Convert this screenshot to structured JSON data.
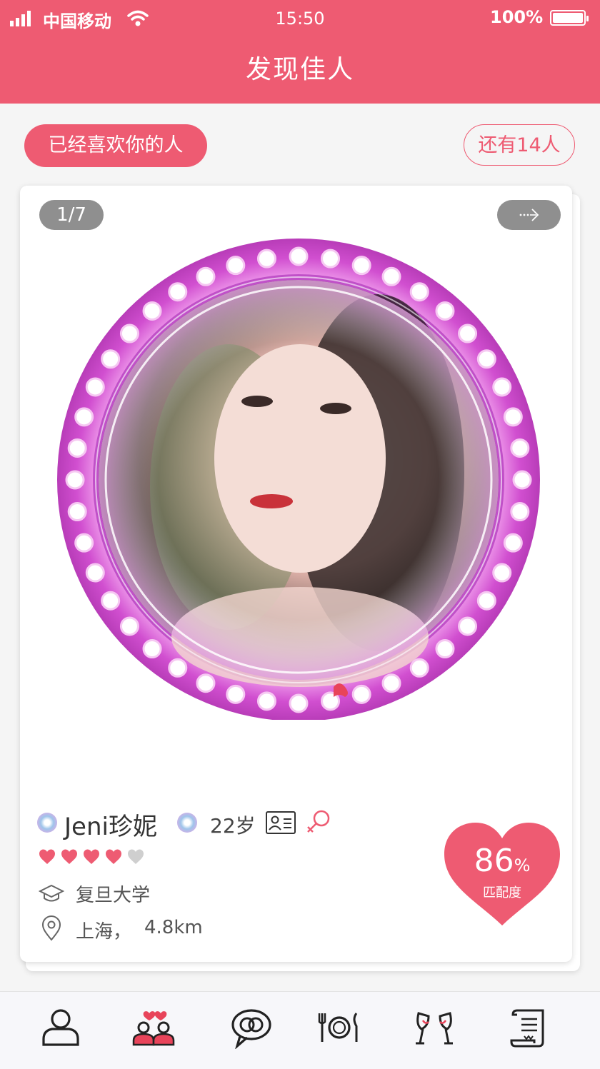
{
  "status": {
    "carrier": "中国移动",
    "time": "15:50",
    "battery": "100%"
  },
  "header": {
    "title": "发现佳人"
  },
  "liked": {
    "label": "已经喜欢你的人",
    "remaining": "还有14人"
  },
  "card": {
    "pager": "1/7",
    "next_label": "···>",
    "profile": {
      "name": "Jeni珍妮",
      "age": "22岁",
      "rating": 4,
      "rating_max": 5,
      "school": "复旦大学",
      "city": "上海，",
      "distance": "4.8km"
    },
    "match": {
      "value": "86",
      "unit": "%",
      "label": "匹配度"
    }
  },
  "tabs": [
    "profile-icon",
    "couple-icon",
    "chat-icon",
    "dining-icon",
    "toast-icon",
    "scroll-icon"
  ],
  "colors": {
    "accent": "#ee5b72",
    "ring": "#d14fd0",
    "gray_btn": "#8f8f8f"
  }
}
